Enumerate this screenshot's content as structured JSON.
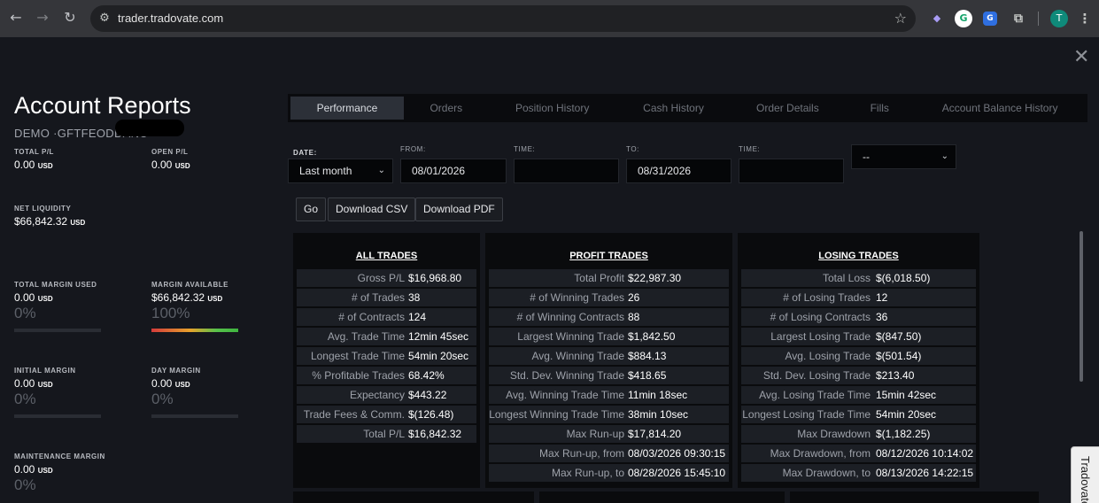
{
  "browser": {
    "url": "trader.tradovate.com",
    "nav_back": "←",
    "nav_forward": "→",
    "nav_reload": "↻",
    "site_info_icon": "⚙",
    "bookmark_icon": "☆",
    "menu_icon": "⋮",
    "avatar_letter": "T",
    "ext_grammarly": "G",
    "ext_other": "G",
    "ext_puzzle": "⧉"
  },
  "page": {
    "close": "✕",
    "title": "Account Reports",
    "account": "DEMO ·GFTFEODDANC"
  },
  "stats": {
    "total_pl": {
      "label": "TOTAL P/L",
      "value": "0.00",
      "unit": "USD"
    },
    "open_pl": {
      "label": "OPEN P/L",
      "value": "0.00",
      "unit": "USD"
    },
    "net_liquidity": {
      "label": "NET LIQUIDITY",
      "value": "$66,842.32",
      "unit": "USD"
    },
    "total_margin_used": {
      "label": "TOTAL MARGIN USED",
      "value": "0.00",
      "unit": "USD",
      "pct": "0%"
    },
    "margin_available": {
      "label": "MARGIN AVAILABLE",
      "value": "$66,842.32",
      "unit": "USD",
      "pct": "100%"
    },
    "initial_margin": {
      "label": "INITIAL MARGIN",
      "value": "0.00",
      "unit": "USD",
      "pct": "0%"
    },
    "day_margin": {
      "label": "DAY MARGIN",
      "value": "0.00",
      "unit": "USD",
      "pct": "0%"
    },
    "maintenance_margin": {
      "label": "MAINTENANCE MARGIN",
      "value": "0.00",
      "unit": "USD",
      "pct": "0%"
    }
  },
  "tabs": [
    "Performance",
    "Orders",
    "Position History",
    "Cash History",
    "Order Details",
    "Fills",
    "Account Balance History"
  ],
  "filters": {
    "date_label": "DATE:",
    "date_value": "Last month",
    "from_label": "FROM:",
    "from_value": "08/01/2026",
    "time_label": "TIME:",
    "to_label": "TO:",
    "to_value": "08/31/2026",
    "time2_label": "TIME:",
    "extra_value": "--",
    "caret": "⌄"
  },
  "buttons": {
    "go": "Go",
    "download_csv": "Download CSV",
    "download_pdf": "Download PDF"
  },
  "all_trades": {
    "title": "ALL TRADES",
    "rows": [
      {
        "k": "Gross P/L",
        "v": "$16,968.80"
      },
      {
        "k": "# of Trades",
        "v": "38"
      },
      {
        "k": "# of Contracts",
        "v": "124"
      },
      {
        "k": "Avg. Trade Time",
        "v": "12min 45sec"
      },
      {
        "k": "Longest Trade Time",
        "v": "54min 20sec"
      },
      {
        "k": "% Profitable Trades",
        "v": "68.42%"
      },
      {
        "k": "Expectancy",
        "v": "$443.22"
      },
      {
        "k": "Trade Fees & Comm.",
        "v": "$(126.48)"
      },
      {
        "k": "Total P/L",
        "v": "$16,842.32"
      }
    ]
  },
  "profit_trades": {
    "title": "PROFIT TRADES",
    "rows": [
      {
        "k": "Total Profit",
        "v": "$22,987.30"
      },
      {
        "k": "# of Winning Trades",
        "v": "26"
      },
      {
        "k": "# of Winning Contracts",
        "v": "88"
      },
      {
        "k": "Largest Winning Trade",
        "v": "$1,842.50"
      },
      {
        "k": "Avg. Winning Trade",
        "v": "$884.13"
      },
      {
        "k": "Std. Dev. Winning Trade",
        "v": "$418.65"
      },
      {
        "k": "Avg. Winning Trade Time",
        "v": "11min 18sec"
      },
      {
        "k": "Longest Winning Trade Time",
        "v": "38min 10sec"
      },
      {
        "k": "Max Run-up",
        "v": "$17,814.20"
      },
      {
        "k": "Max Run-up, from",
        "v": "08/03/2026 09:30:15"
      },
      {
        "k": "Max Run-up, to",
        "v": "08/28/2026 15:45:10"
      }
    ]
  },
  "losing_trades": {
    "title": "LOSING TRADES",
    "rows": [
      {
        "k": "Total Loss",
        "v": "$(6,018.50)"
      },
      {
        "k": "# of Losing Trades",
        "v": "12"
      },
      {
        "k": "# of Losing Contracts",
        "v": "36"
      },
      {
        "k": "Largest Losing Trade",
        "v": "$(847.50)"
      },
      {
        "k": "Avg. Losing Trade",
        "v": "$(501.54)"
      },
      {
        "k": "Std. Dev. Losing Trade",
        "v": "$213.40"
      },
      {
        "k": "Avg. Losing Trade Time",
        "v": "15min 42sec"
      },
      {
        "k": "Longest Losing Trade Time",
        "v": "54min 20sec"
      },
      {
        "k": "Max Drawdown",
        "v": "$(1,182.25)"
      },
      {
        "k": "Max Drawdown, from",
        "v": "08/12/2026 10:14:02"
      },
      {
        "k": "Max Drawdown, to",
        "v": "08/13/2026 14:22:15"
      }
    ]
  },
  "side_tab": "Tradovate"
}
